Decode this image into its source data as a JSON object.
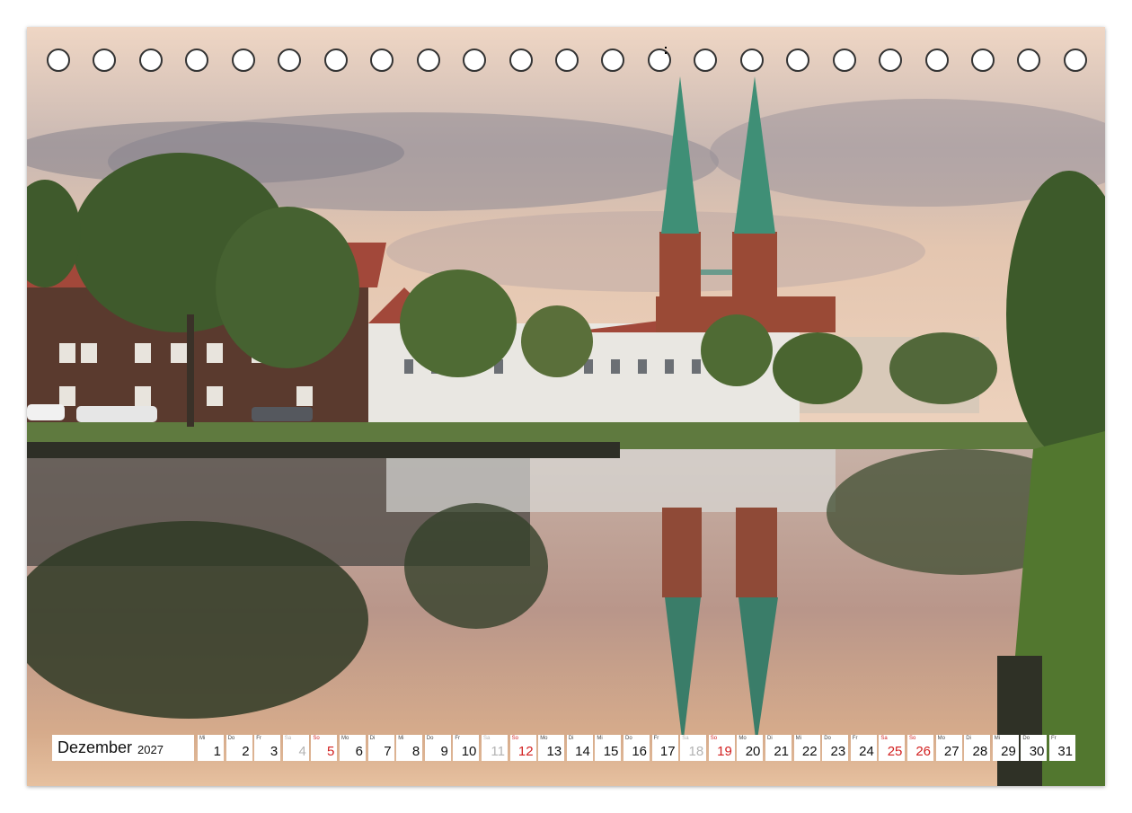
{
  "calendar": {
    "month": "Dezember",
    "year": "2027",
    "days": [
      {
        "wd": "Mi",
        "n": "1",
        "t": "w"
      },
      {
        "wd": "Do",
        "n": "2",
        "t": "w"
      },
      {
        "wd": "Fr",
        "n": "3",
        "t": "w"
      },
      {
        "wd": "Sa",
        "n": "4",
        "t": "sat"
      },
      {
        "wd": "So",
        "n": "5",
        "t": "sun"
      },
      {
        "wd": "Mo",
        "n": "6",
        "t": "w"
      },
      {
        "wd": "Di",
        "n": "7",
        "t": "w"
      },
      {
        "wd": "Mi",
        "n": "8",
        "t": "w"
      },
      {
        "wd": "Do",
        "n": "9",
        "t": "w"
      },
      {
        "wd": "Fr",
        "n": "10",
        "t": "w"
      },
      {
        "wd": "Sa",
        "n": "11",
        "t": "sat"
      },
      {
        "wd": "So",
        "n": "12",
        "t": "sun"
      },
      {
        "wd": "Mo",
        "n": "13",
        "t": "w"
      },
      {
        "wd": "Di",
        "n": "14",
        "t": "w"
      },
      {
        "wd": "Mi",
        "n": "15",
        "t": "w"
      },
      {
        "wd": "Do",
        "n": "16",
        "t": "w"
      },
      {
        "wd": "Fr",
        "n": "17",
        "t": "w"
      },
      {
        "wd": "Sa",
        "n": "18",
        "t": "sat"
      },
      {
        "wd": "So",
        "n": "19",
        "t": "sun"
      },
      {
        "wd": "Mo",
        "n": "20",
        "t": "w"
      },
      {
        "wd": "Di",
        "n": "21",
        "t": "w"
      },
      {
        "wd": "Mi",
        "n": "22",
        "t": "w"
      },
      {
        "wd": "Do",
        "n": "23",
        "t": "w"
      },
      {
        "wd": "Fr",
        "n": "24",
        "t": "w"
      },
      {
        "wd": "Sa",
        "n": "25",
        "t": "hol"
      },
      {
        "wd": "So",
        "n": "26",
        "t": "sun"
      },
      {
        "wd": "Mo",
        "n": "27",
        "t": "w"
      },
      {
        "wd": "Di",
        "n": "28",
        "t": "w"
      },
      {
        "wd": "Mi",
        "n": "29",
        "t": "w"
      },
      {
        "wd": "Do",
        "n": "30",
        "t": "w"
      },
      {
        "wd": "Fr",
        "n": "31",
        "t": "w"
      }
    ]
  },
  "binding": {
    "ring_count": 23
  },
  "colors": {
    "sunday": "#d21f1f",
    "saturday": "#b3b3b3",
    "spire": "#3f8f76",
    "brick": "#9a4a36",
    "sky_top": "#f1d9c6",
    "water": "#c9a088"
  }
}
